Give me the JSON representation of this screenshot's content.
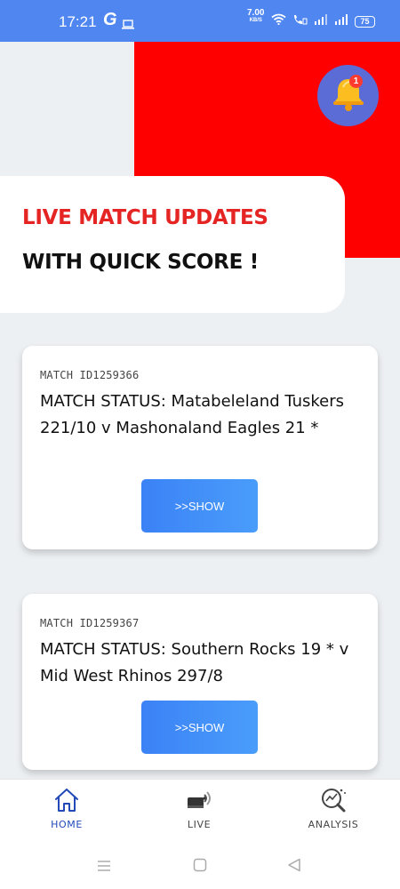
{
  "status_bar": {
    "time": "17:21",
    "g_icon": "G",
    "net_speed": "7.00",
    "net_unit": "KB/S",
    "battery": "75",
    "icons": [
      "laptop-icon",
      "wifi-icon",
      "volte-call-icon",
      "signal-icon",
      "signal-icon",
      "battery-icon"
    ]
  },
  "header": {
    "notification_count": "1"
  },
  "hero": {
    "line1": "LIVE MATCH UPDATES",
    "line2": "WITH QUICK SCORE !"
  },
  "matches": [
    {
      "id": "MATCH ID1259366",
      "status": "MATCH STATUS: Matabeleland Tuskers 221/10  v Mashonaland Eagles 21 *",
      "button": ">>SHOW"
    },
    {
      "id": "MATCH ID1259367",
      "status": "MATCH STATUS: Southern Rocks 19 * v Mid West Rhinos 297/8",
      "button": ">>SHOW"
    }
  ],
  "bottom_nav": {
    "items": [
      {
        "label": "HOME",
        "icon": "home-icon",
        "active": true
      },
      {
        "label": "LIVE",
        "icon": "live-broadcast-icon",
        "active": false
      },
      {
        "label": "ANALYSIS",
        "icon": "analysis-icon",
        "active": false
      }
    ]
  },
  "colors": {
    "status_bar": "#4f86f0",
    "accent_red": "#ff0000",
    "hero_red_text": "#e52424",
    "button_blue": "#3b82f6",
    "active_nav": "#2149b8"
  }
}
